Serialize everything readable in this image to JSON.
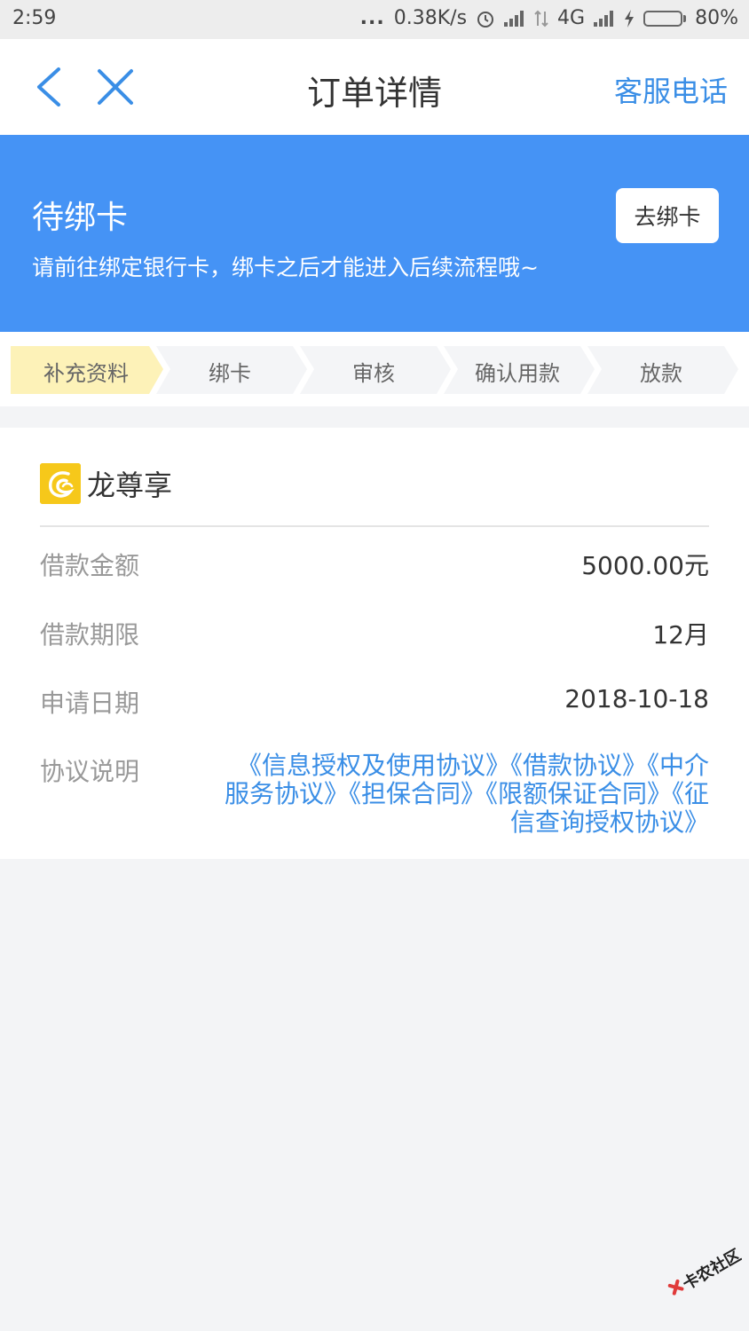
{
  "status_bar": {
    "time": "2:59",
    "dots": "...",
    "speed": "0.38K/s",
    "network": "4G",
    "battery": "80%",
    "battery_level": 0.8
  },
  "nav": {
    "title": "订单详情",
    "action": "客服电话"
  },
  "banner": {
    "title": "待绑卡",
    "description": "请前往绑定银行卡，绑卡之后才能进入后续流程哦~",
    "button": "去绑卡"
  },
  "steps": [
    {
      "label": "补充资料",
      "active": true
    },
    {
      "label": "绑卡",
      "active": false
    },
    {
      "label": "审核",
      "active": false
    },
    {
      "label": "确认用款",
      "active": false
    },
    {
      "label": "放款",
      "active": false
    }
  ],
  "loan": {
    "brand": "龙尊享",
    "rows": [
      {
        "label": "借款金额",
        "value": "5000.00元"
      },
      {
        "label": "借款期限",
        "value": "12月"
      },
      {
        "label": "申请日期",
        "value": "2018-10-18"
      }
    ],
    "agreement_label": "协议说明",
    "agreements": [
      "《信息授权及使用协议》",
      "《借款协议》",
      "《中介服务协议》",
      "《担保合同》",
      "《限额保证合同》",
      "《征信查询授权协议》"
    ]
  },
  "watermark": {
    "text": "卡农社区"
  },
  "colors": {
    "primary": "#4593f5",
    "link": "#3a8ee6",
    "active_step": "#fdf2b8",
    "inactive_step": "#f4f5f7",
    "brand_logo": "#f6c81a"
  }
}
